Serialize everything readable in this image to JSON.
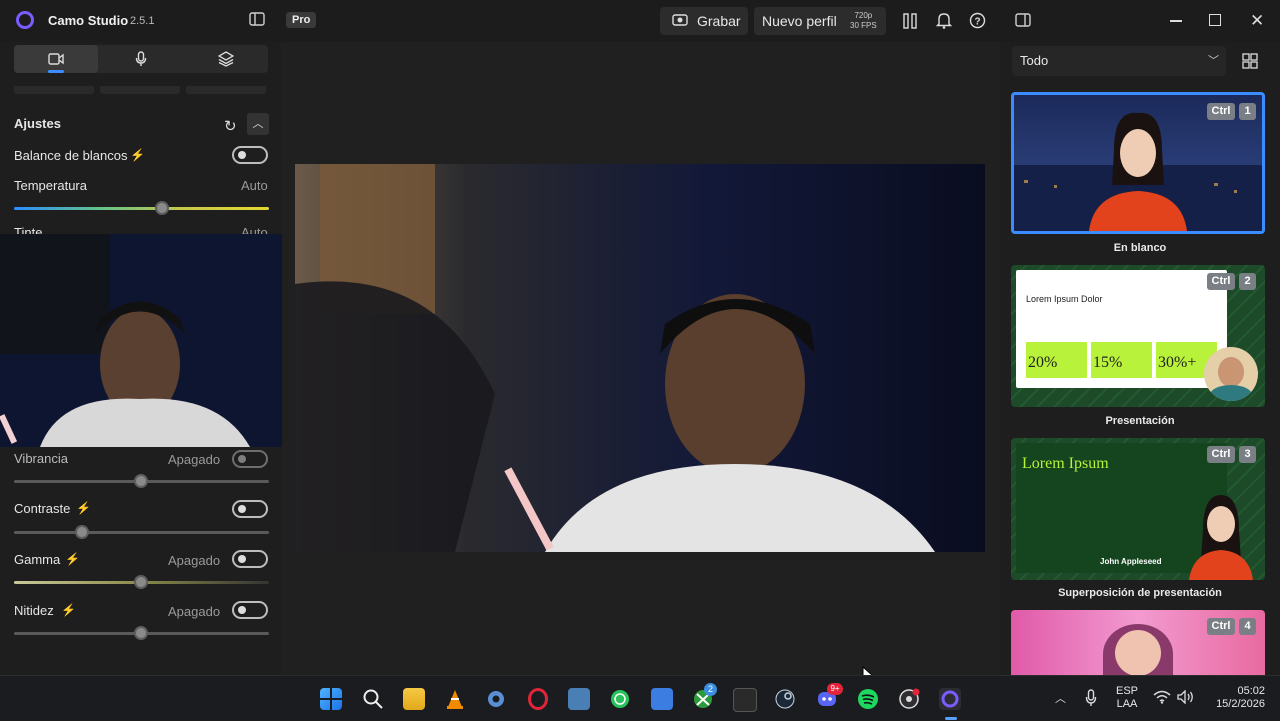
{
  "app": {
    "name": "Camo Studio",
    "version": "2.5.1",
    "badge": "Pro"
  },
  "toolbar": {
    "record_label": "Grabar",
    "profile_label": "Nuevo perfil",
    "resolution": "720p",
    "fps": "30 FPS"
  },
  "left_panel": {
    "section_title": "Ajustes",
    "settings": [
      {
        "label": "Balance de blancos",
        "value": ""
      },
      {
        "label": "Temperatura",
        "value": "Auto",
        "slider_position": 0.59
      },
      {
        "label": "Tinte",
        "value": "Auto"
      },
      {
        "label": "Vibrancia",
        "value": "Apagado",
        "slider_position": 0.5
      },
      {
        "label": "Contraste",
        "value": "",
        "slider_position": 0.27
      },
      {
        "label": "Gamma",
        "value": "Apagado",
        "slider_position": 0.5
      },
      {
        "label": "Nitidez",
        "value": "Apagado",
        "slider_position": 0.5
      }
    ]
  },
  "right_panel": {
    "filter_label": "Todo",
    "scenes": [
      {
        "label": "En blanco",
        "kbd": "Ctrl",
        "number": "1",
        "selected": true
      },
      {
        "label": "Presentación",
        "kbd": "Ctrl",
        "number": "2",
        "slide_title": "Lorem Ipsum Dolor",
        "stats": [
          "20%",
          "15%",
          "30%+"
        ]
      },
      {
        "label": "Superposición de presentación",
        "kbd": "Ctrl",
        "number": "3",
        "slide_title": "Lorem Ipsum",
        "presenter": "John Appleseed"
      },
      {
        "label": "",
        "kbd": "Ctrl",
        "number": "4"
      }
    ]
  },
  "taskbar": {
    "apps": [
      "start-icon",
      "search-icon",
      "file-explorer-icon",
      "vlc-icon",
      "settings-icon",
      "opera-icon",
      "app-icon",
      "whatsapp-icon",
      "store-icon",
      "xbox-icon",
      "epic-games-icon",
      "steam-icon",
      "discord-icon",
      "spotify-icon",
      "obs-icon",
      "camo-icon"
    ],
    "xbox_badge": "2",
    "discord_badge": "9+",
    "language": "ESP",
    "layout": "LAA",
    "time": "05:02",
    "date": "15/2/2026"
  },
  "colors": {
    "accent": "#3b8cff",
    "brand": "#7b5cff",
    "green_slide": "#1f5a2a",
    "lime": "#b8f23a"
  }
}
